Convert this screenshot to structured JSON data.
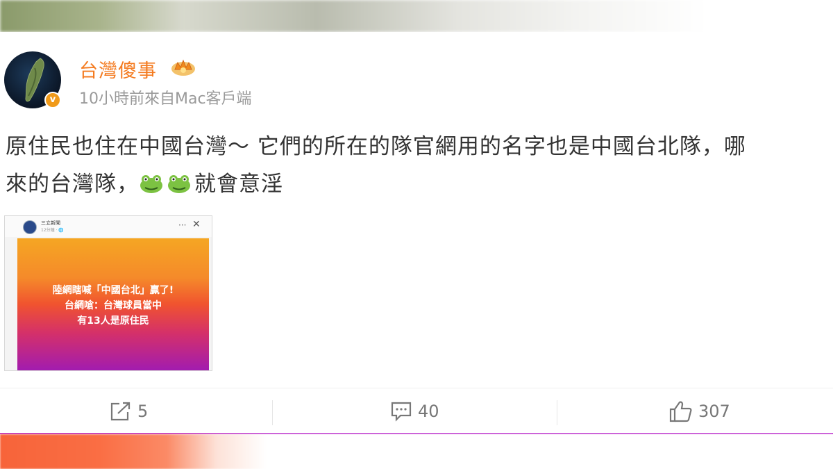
{
  "post": {
    "username": "台灣傻事",
    "meta": "10小時前來自Mac客戶端",
    "content_line1": "原住民也住在中國台灣～ 它們的所在的隊官網用的名字也是中國台北隊，哪",
    "content_line2_a": "來的台灣隊，",
    "content_line2_b": "就會意淫",
    "verified_mark": "v",
    "emoji": "frog-icon"
  },
  "embedded_image": {
    "source_name": "三立新聞",
    "source_time": "12分鐘 · 🌐",
    "dots": "···",
    "close": "✕",
    "text_line1": "陸網瞎喊「中國台北」贏了!",
    "text_line2": "台網嗆：台灣球員當中",
    "text_line3": "有13人是原住民"
  },
  "actions": {
    "repost_count": "5",
    "comment_count": "40",
    "like_count": "307"
  },
  "colors": {
    "username": "#f47b20",
    "meta": "#9a9a9a",
    "text": "#333333",
    "action": "#777777",
    "divider": "#c040d0"
  }
}
